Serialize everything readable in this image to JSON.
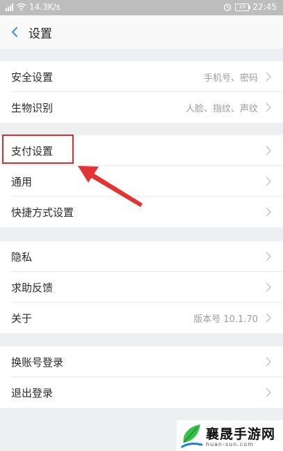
{
  "status_bar": {
    "network_speed": "14.3K/s",
    "battery": "20",
    "time": "22:45"
  },
  "header": {
    "back_icon": "chevron-left-icon",
    "title": "设置"
  },
  "groups": [
    {
      "items": [
        {
          "label": "安全设置",
          "value": "手机号、密码"
        },
        {
          "label": "生物识别",
          "value": "人脸、指纹、声纹"
        }
      ]
    },
    {
      "items": [
        {
          "label": "支付设置",
          "value": ""
        },
        {
          "label": "通用",
          "value": ""
        },
        {
          "label": "快捷方式设置",
          "value": ""
        }
      ]
    },
    {
      "items": [
        {
          "label": "隐私",
          "value": ""
        },
        {
          "label": "求助反馈",
          "value": ""
        },
        {
          "label": "关于",
          "value": "版本号 10.1.70"
        }
      ]
    },
    {
      "items": [
        {
          "label": "换账号登录",
          "value": ""
        },
        {
          "label": "退出登录",
          "value": ""
        }
      ]
    }
  ],
  "annotation": {
    "highlight_color": "#e02a2a",
    "highlighted_item": "支付设置"
  },
  "watermark": {
    "title": "襄晟手游网",
    "url": "huan-sun.com"
  }
}
